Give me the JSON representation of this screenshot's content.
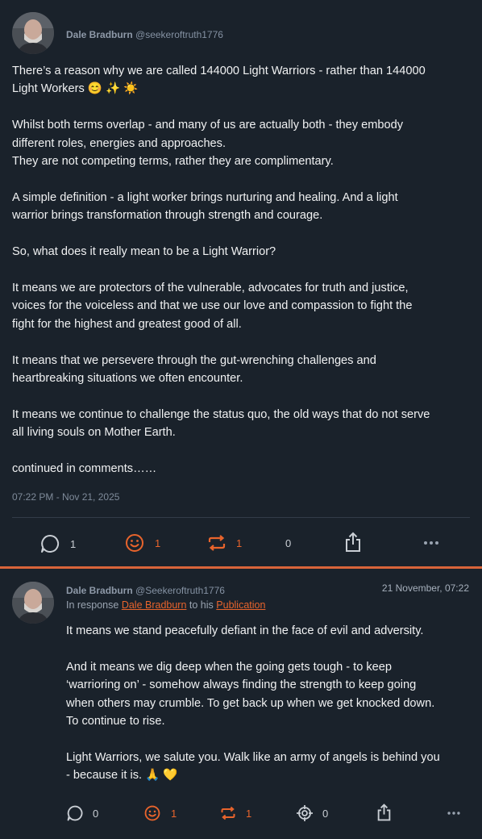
{
  "post": {
    "author_name": "Dale Bradburn",
    "author_handle": "@seekeroftruth1776",
    "body": "There’s a reason why we are called 144000 Light Warriors - rather than 144000\nLight Workers 😊 ✨ ☀️\n\nWhilst both terms overlap - and many of us are actually both - they embody\ndifferent roles, energies and approaches.\nThey are not competing terms, rather they are complimentary.\n\nA simple definition - a light worker brings nurturing and healing. And a light\nwarrior brings transformation through strength and courage.\n\nSo, what does it really mean to be a Light Warrior?\n\nIt means we are protectors of the vulnerable, advocates for truth and justice,\nvoices for the voiceless and that we use our love and compassion to fight the\nfight for the highest and greatest good of all.\n\nIt means that we persevere through the gut-wrenching challenges and\nheartbreaking situations we often encounter.\n\nIt means we continue to challenge the status quo, the old ways that do not serve\nall living souls on Mother Earth.\n\ncontinued in comments……",
    "timestamp": "07:22 PM - Nov 21, 2025",
    "actions": {
      "reply_count": "1",
      "react_count": "1",
      "repost_count": "1",
      "quote_count": "0"
    }
  },
  "reply": {
    "author_name": "Dale Bradburn",
    "author_handle": "@Seekeroftruth1776",
    "date": "21 November, 07:22",
    "in_response_prefix": "In response",
    "in_response_author": "Dale Bradburn",
    "in_response_mid": "to his",
    "in_response_target": "Publication",
    "body": "It means we stand peacefully defiant in the face of evil and adversity.\n\nAnd it means we dig deep when the going gets tough - to keep\n‘warrioring on’ - somehow always finding the strength to keep going\nwhen others may crumble. To get back up when we get knocked down.\nTo continue to rise.\n\nLight Warriors, we salute you. Walk like an army of angels is behind you\n- because it is. 🙏 💛",
    "actions": {
      "reply_count": "0",
      "react_count": "1",
      "repost_count": "1",
      "zap_count": "0"
    }
  },
  "colors": {
    "background": "#1a222b",
    "accent": "#e8642c",
    "muted_text": "#8592a3",
    "divider": "#323c48"
  },
  "icons": [
    "comment-icon",
    "smiley-icon",
    "repost-icon",
    "more-icon",
    "share-icon",
    "target-icon"
  ]
}
